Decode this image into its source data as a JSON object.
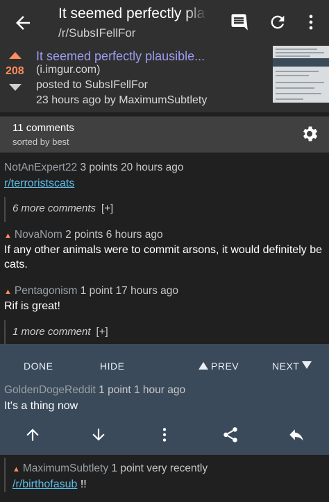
{
  "appbar": {
    "title": "It seemed perfectly plausible...",
    "subreddit": "/r/SubsIFellFor",
    "icons": [
      "back-arrow-icon",
      "comment-icon",
      "refresh-icon",
      "more-vert-icon"
    ]
  },
  "post": {
    "score": "208",
    "title": "It seemed perfectly plausible...",
    "domain": "(i.imgur.com)",
    "subreddit_line": "posted to SubsIFellFor",
    "time_line": "23 hours ago by MaximumSubtlety"
  },
  "comments_header": {
    "count": "11 comments",
    "sort": "sorted by best"
  },
  "comments": [
    {
      "author": "NotAnExpert22",
      "meta": "3 points 20 hours ago",
      "body": "r/terroristscats"
    },
    {
      "more": "6 more comments",
      "plus": "[+]"
    },
    {
      "author": "NovaNom",
      "meta": "2 points 6 hours ago",
      "body": "If any other animals were to commit arsons, it would definitely be cats."
    },
    {
      "author": "Pentagonism",
      "meta": "1 point 17 hours ago",
      "body": "Rif is great!"
    },
    {
      "more": "1 more comment",
      "plus": "[+]"
    },
    {
      "author": "GoldenDogeReddit",
      "meta": "1 point 1 hour ago",
      "body": "It's a thing now"
    },
    {
      "author": "MaximumSubtlety",
      "meta": "1 point very recently",
      "body_link": "/r/birthofasub",
      "body_suffix": " !!"
    }
  ],
  "nav_panel": {
    "done": "DONE",
    "hide": "HIDE",
    "prev": "PREV",
    "next": "NEXT",
    "icons": [
      "arrow-up-icon",
      "arrow-down-icon",
      "more-vert-icon",
      "share-icon",
      "reply-icon"
    ]
  },
  "colors": {
    "appbar": "#303030",
    "background": "#202020",
    "upvote": "#ff8b5e",
    "post_title": "#9c9cf2",
    "link": "#5bbde8",
    "nav_panel": "#3a4a5a"
  }
}
